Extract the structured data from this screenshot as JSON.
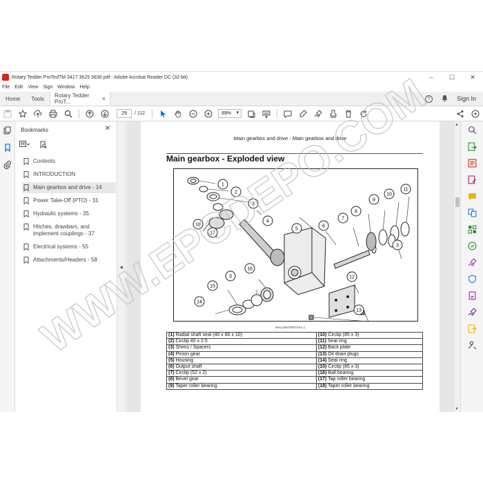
{
  "window": {
    "title": "Rotary Tedder ProTedTM 3417 3625 3836.pdf - Adobe Acrobat Reader DC (32-bit)",
    "minimize": "–",
    "maximize": "☐",
    "close": "✕"
  },
  "menubar": [
    "File",
    "Edit",
    "View",
    "Sign",
    "Window",
    "Help"
  ],
  "tabs": {
    "home": "Home",
    "tools": "Tools",
    "document": "Rotary Tedder ProT...",
    "close": "×",
    "signin": "Sign In"
  },
  "toolbar": {
    "page_current": "29",
    "page_total": "/ 112",
    "zoom": "89%",
    "icons": [
      "save-icon",
      "star-icon",
      "upload-icon",
      "print-icon",
      "find-icon",
      "page-up-icon",
      "page-down-icon",
      "cursor-icon",
      "hand-icon",
      "zoom-out-icon",
      "zoom-in-icon",
      "fit-page-icon",
      "keyboard-icon",
      "comment-icon",
      "highlight-icon",
      "sign-icon",
      "stamp-icon",
      "delete-icon",
      "rotate-icon",
      "share-icon",
      "mail-icon"
    ]
  },
  "bookmarks": {
    "title": "Bookmarks",
    "close": "✕",
    "items": [
      {
        "label": "Contents"
      },
      {
        "label": "INTRODUCTION"
      },
      {
        "label": "Main gearbox and drive - 14",
        "selected": true
      },
      {
        "label": "Power Take-Off (PTO) - 31"
      },
      {
        "label": "Hydraulic systems - 35"
      },
      {
        "label": "Hitches, drawbars, and implement couplings - 37"
      },
      {
        "label": "Electrical systems - 55"
      },
      {
        "label": "Attachments/Headers - 58"
      }
    ]
  },
  "page": {
    "header": "Main gearbox and drive - Main gearbox and drive",
    "section_title": "Main gearbox - Exploded view",
    "caption": "NHIL19HT00074AA     1",
    "callouts": [
      "1",
      "2",
      "3",
      "4",
      "5",
      "6",
      "7",
      "8",
      "9",
      "10",
      "11",
      "3",
      "12",
      "13",
      "13",
      "3",
      "14",
      "15",
      "16",
      "17",
      "18"
    ],
    "parts_left": [
      {
        "num": "(1)",
        "name": "Radial shaft seal (40 x 80 x 10)"
      },
      {
        "num": "(2)",
        "name": "Circlip 40 x 2.5"
      },
      {
        "num": "(3)",
        "name": "Shims / Spacers"
      },
      {
        "num": "(4)",
        "name": "Pinion gear"
      },
      {
        "num": "(5)",
        "name": "Housing"
      },
      {
        "num": "(6)",
        "name": "Output shaft"
      },
      {
        "num": "(7)",
        "name": "Circlip (52 x 2)"
      },
      {
        "num": "(8)",
        "name": "Bevel gear"
      },
      {
        "num": "(9)",
        "name": "Taper roller bearing"
      }
    ],
    "parts_right": [
      {
        "num": "(10)",
        "name": "Circlip (85 x 3)"
      },
      {
        "num": "(11)",
        "name": "Seal ring"
      },
      {
        "num": "(12)",
        "name": "Back plate"
      },
      {
        "num": "(13)",
        "name": "Oil drain plugs"
      },
      {
        "num": "(14)",
        "name": "Seal ring"
      },
      {
        "num": "(15)",
        "name": "Circlip (85 x 3)"
      },
      {
        "num": "(16)",
        "name": "Ball bearing"
      },
      {
        "num": "(17)",
        "name": "Tap roller bearing"
      },
      {
        "num": "(18)",
        "name": "Taper roller bearing"
      }
    ]
  },
  "watermark": "WWW.EPCDEPO.COM",
  "colors": {
    "accent": "#1473e6",
    "app_red": "#d7261e",
    "watermark": "#c8c8c8"
  }
}
